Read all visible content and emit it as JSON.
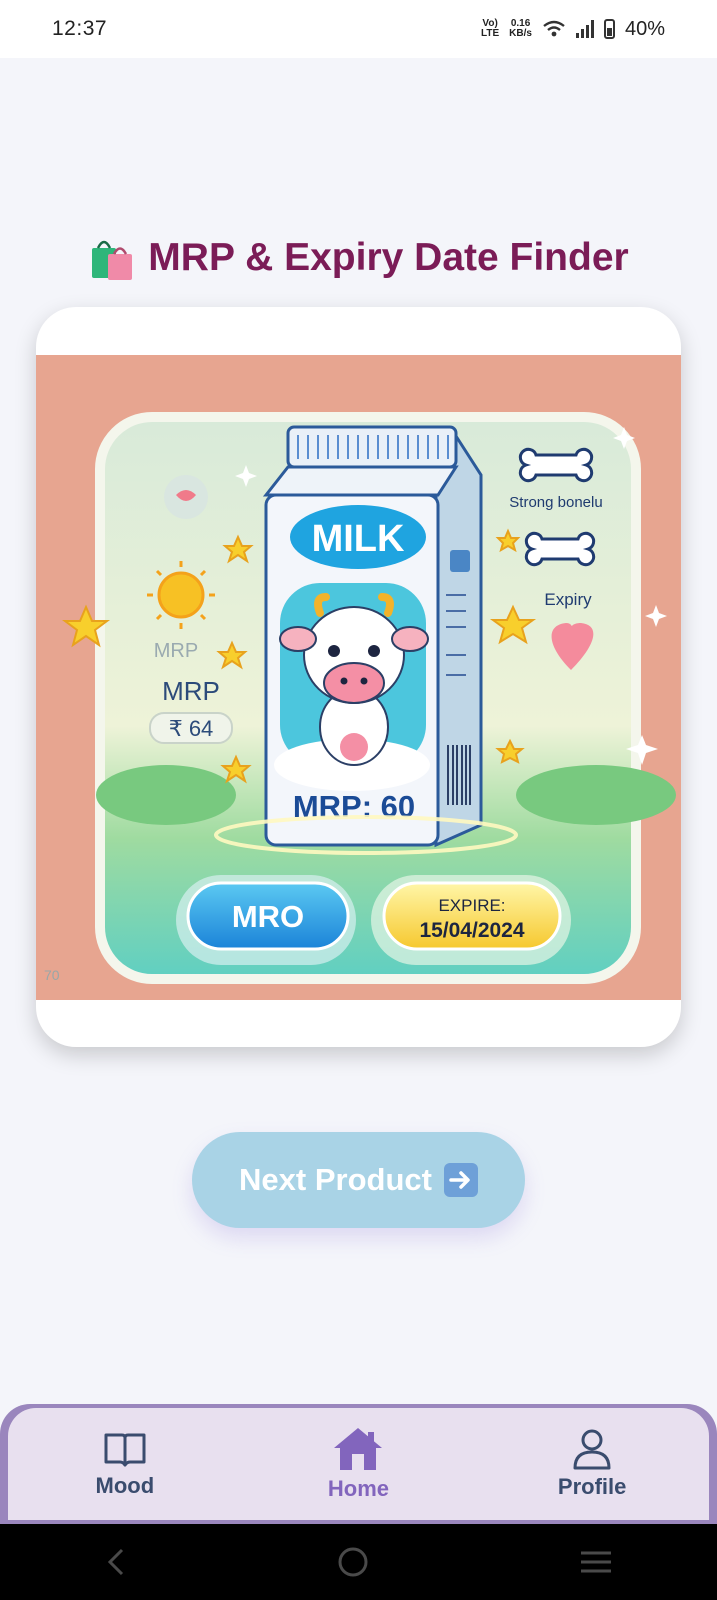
{
  "status_bar": {
    "time": "12:37",
    "network_top": "Vo)",
    "network_bottom": "LTE",
    "speed_value": "0.16",
    "speed_unit": "KB/s",
    "battery": "40%"
  },
  "page": {
    "title": "MRP & Expiry Date Finder",
    "title_icon": "shopping-bags-icon"
  },
  "product_card": {
    "image_text": {
      "milk": "MILK",
      "mrp_faded": "MRP",
      "mrp": "MRP",
      "rupee_price": "₹ 64",
      "carton_mrp": "MRP: 60",
      "strong_bones": "Strong bonelu",
      "expiry_side": "Expiry",
      "mro_button": "MRO",
      "expire_label": "EXPIRE:",
      "expire_date": "15/04/2024",
      "corner_text": "70"
    }
  },
  "actions": {
    "next_label": "Next Product",
    "next_icon": "right-arrow-icon"
  },
  "bottom_nav": {
    "items": [
      {
        "label": "Mood",
        "icon": "book-icon",
        "active": false
      },
      {
        "label": "Home",
        "icon": "home-icon",
        "active": true
      },
      {
        "label": "Profile",
        "icon": "user-icon",
        "active": false
      }
    ]
  },
  "colors": {
    "title": "#7b1c57",
    "accent": "#8265bd",
    "nav_text": "#3a4c6e",
    "button_bg": "#a9d3e6"
  }
}
